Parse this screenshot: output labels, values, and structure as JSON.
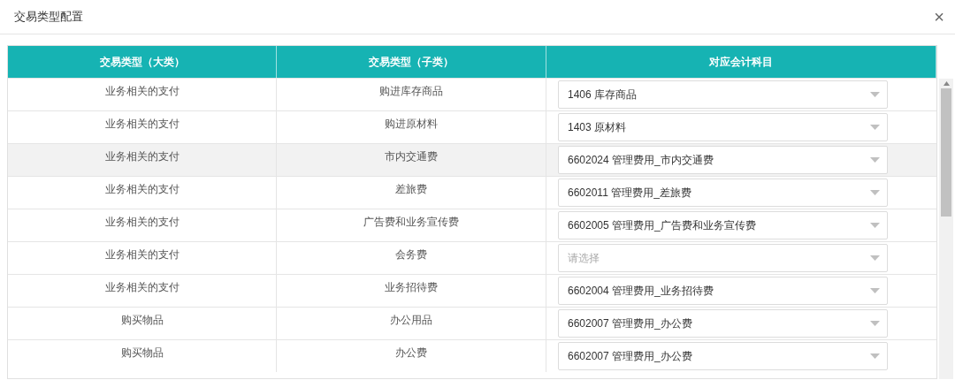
{
  "dialog": {
    "title": "交易类型配置",
    "close": "×"
  },
  "table": {
    "columns": [
      "交易类型（大类）",
      "交易类型（子类）",
      "对应会计科目"
    ],
    "rows": [
      {
        "category": "业务相关的支付",
        "subtype": "购进库存商品",
        "account": {
          "value": "1406 库存商品"
        },
        "selected": false
      },
      {
        "category": "业务相关的支付",
        "subtype": "购进原材料",
        "account": {
          "value": "1403 原材料"
        },
        "selected": false
      },
      {
        "category": "业务相关的支付",
        "subtype": "市内交通费",
        "account": {
          "value": "6602024 管理费用_市内交通费"
        },
        "selected": true
      },
      {
        "category": "业务相关的支付",
        "subtype": "差旅费",
        "account": {
          "value": "6602011 管理费用_差旅费"
        },
        "selected": false
      },
      {
        "category": "业务相关的支付",
        "subtype": "广告费和业务宣传费",
        "account": {
          "value": "6602005 管理费用_广告费和业务宣传费"
        },
        "selected": false
      },
      {
        "category": "业务相关的支付",
        "subtype": "会务费",
        "account": {
          "placeholder": "请选择"
        },
        "selected": false
      },
      {
        "category": "业务相关的支付",
        "subtype": "业务招待费",
        "account": {
          "value": "6602004 管理费用_业务招待费"
        },
        "selected": false
      },
      {
        "category": "购买物品",
        "subtype": "办公用品",
        "account": {
          "value": "6602007 管理费用_办公费"
        },
        "selected": false
      },
      {
        "category": "购买物品",
        "subtype": "办公费",
        "account": {
          "value": "6602007 管理费用_办公费"
        },
        "selected": false
      }
    ]
  }
}
